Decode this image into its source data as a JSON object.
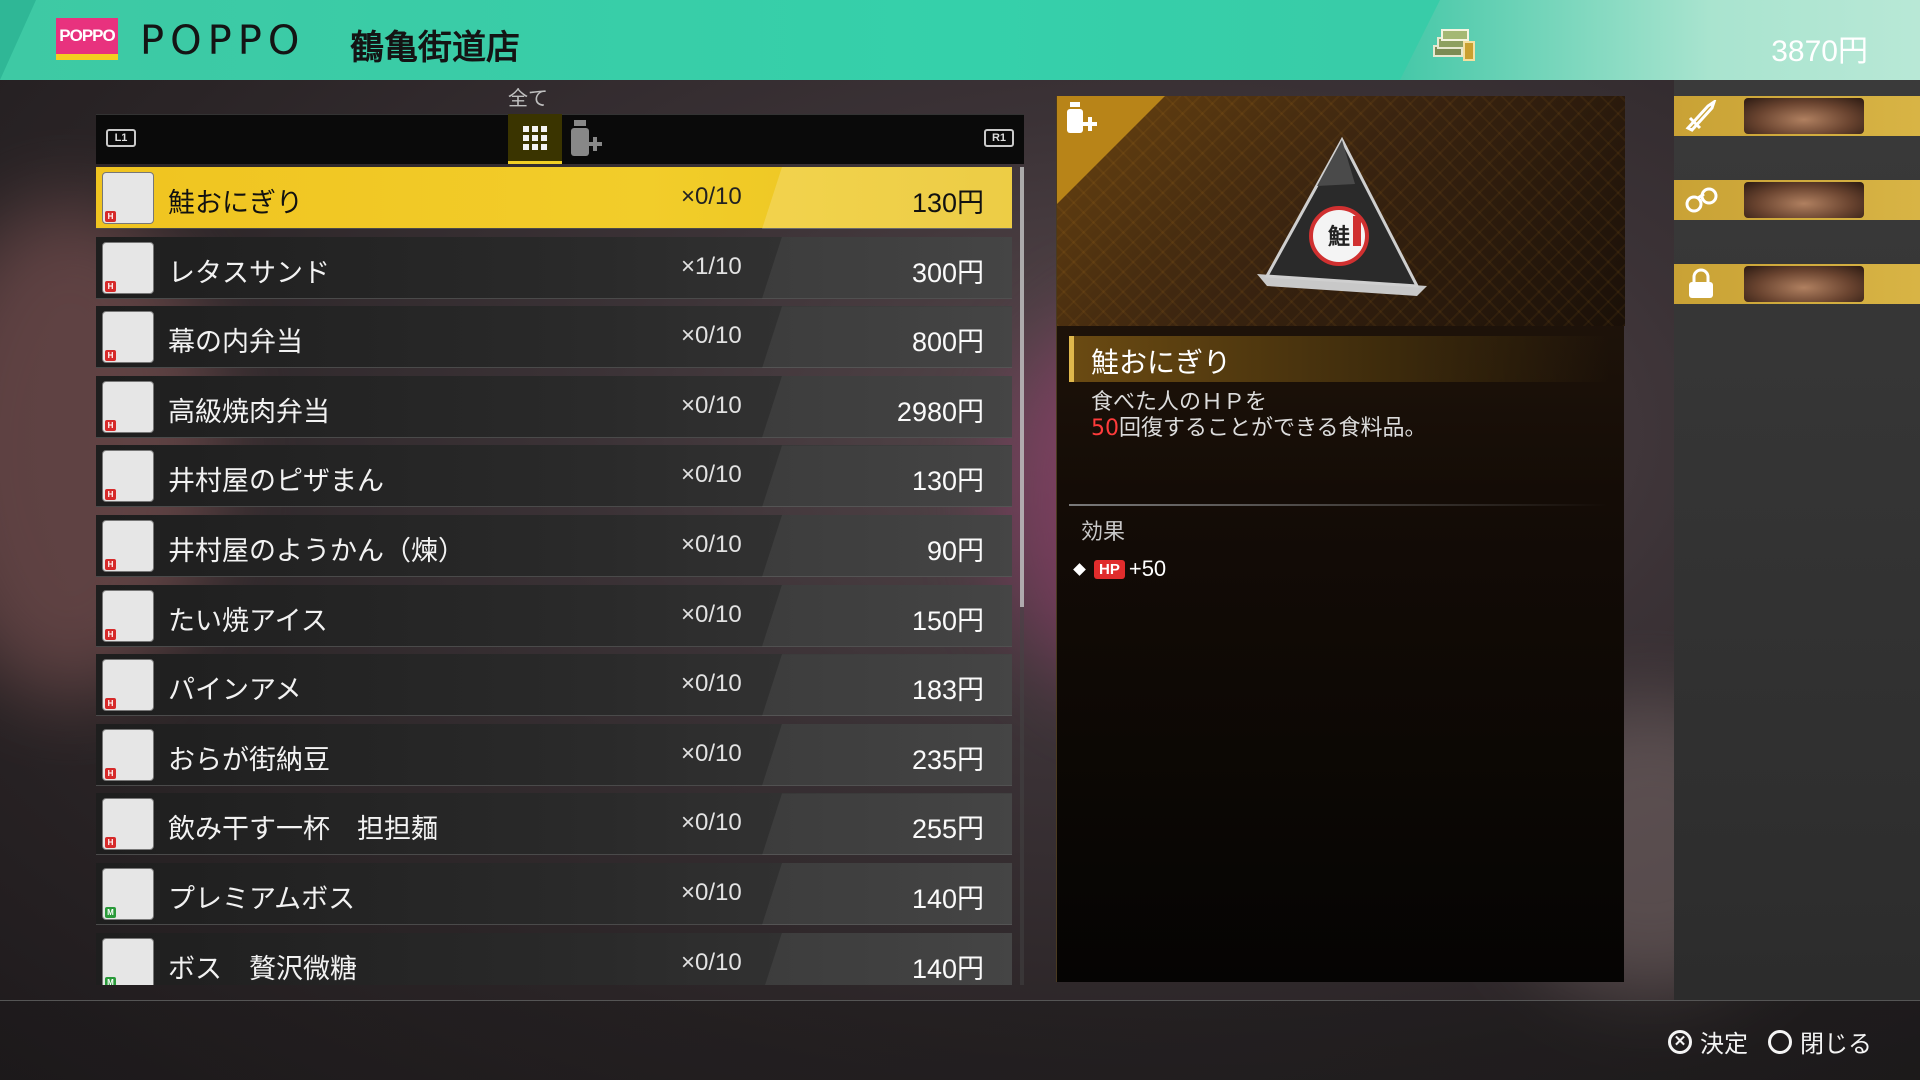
{
  "header": {
    "logo_text": "POPPO",
    "store_brand": "POPPO",
    "store_name": "鶴亀街道店",
    "money": "3870円"
  },
  "category": {
    "label": "全て",
    "left_button": "L1",
    "right_button": "R1",
    "tabs": [
      {
        "icon": "grid-icon",
        "active": true
      },
      {
        "icon": "recovery-bottle-icon",
        "active": false
      }
    ]
  },
  "items": [
    {
      "name": "鮭おにぎり",
      "qty": "×0/10",
      "price": "130円",
      "icon": "onigiri-icon",
      "tag": "H",
      "selected": true
    },
    {
      "name": "レタスサンド",
      "qty": "×1/10",
      "price": "300円",
      "icon": "sandwich-icon",
      "tag": "H"
    },
    {
      "name": "幕の内弁当",
      "qty": "×0/10",
      "price": "800円",
      "icon": "bento-icon",
      "tag": "H"
    },
    {
      "name": "高級焼肉弁当",
      "qty": "×0/10",
      "price": "2980円",
      "icon": "yakiniku-bento-icon",
      "tag": "H"
    },
    {
      "name": "井村屋のピザまん",
      "qty": "×0/10",
      "price": "130円",
      "icon": "pizza-bun-icon",
      "tag": "H"
    },
    {
      "name": "井村屋のようかん（煉）",
      "qty": "×0/10",
      "price": "90円",
      "icon": "yokan-icon",
      "tag": "H"
    },
    {
      "name": "たい焼アイス",
      "qty": "×0/10",
      "price": "150円",
      "icon": "taiyaki-ice-icon",
      "tag": "H"
    },
    {
      "name": "パインアメ",
      "qty": "×0/10",
      "price": "183円",
      "icon": "pine-candy-icon",
      "tag": "H"
    },
    {
      "name": "おらが街納豆",
      "qty": "×0/10",
      "price": "235円",
      "icon": "natto-icon",
      "tag": "H"
    },
    {
      "name": "飲み干す一杯　担担麺",
      "qty": "×0/10",
      "price": "255円",
      "icon": "cup-noodle-icon",
      "tag": "H"
    },
    {
      "name": "プレミアムボス",
      "qty": "×0/10",
      "price": "140円",
      "icon": "coffee-can-icon",
      "tag": "M"
    },
    {
      "name": "ボス　贅沢微糖",
      "qty": "×0/10",
      "price": "140円",
      "icon": "coffee-can-icon",
      "tag": "M"
    }
  ],
  "detail": {
    "name": "鮭おにぎり",
    "desc_line1": "食べた人のＨＰを",
    "desc_highlight": "50",
    "desc_line2_rest": "回復することができる食料品。",
    "effect_label": "効果",
    "effect_stat": "HP",
    "effect_value": "+50"
  },
  "party": [
    {
      "icon": "sword-icon"
    },
    {
      "icon": "handcuffs-icon"
    },
    {
      "icon": "lock-icon"
    }
  ],
  "footer": {
    "confirm_symbol": "✕",
    "confirm_label": "決定",
    "close_symbol": "○",
    "close_label": "閉じる"
  },
  "colors": {
    "header_accent": "#3ec9a4",
    "selected_row": "#f0c420",
    "hp_highlight": "#ff3b3b"
  }
}
